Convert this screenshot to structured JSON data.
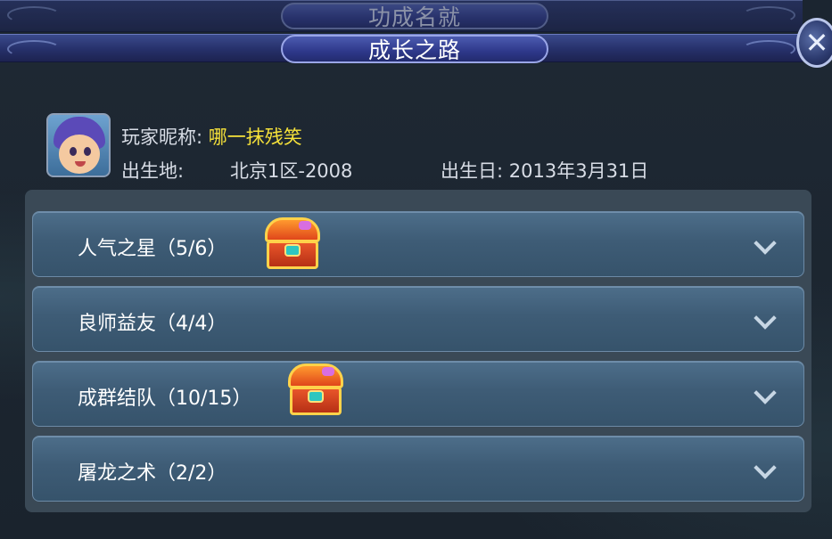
{
  "header": {
    "back_tab_title": "功成名就",
    "front_tab_title": "成长之路",
    "close_symbol": "✕"
  },
  "player": {
    "nickname_label": "玩家昵称:",
    "nickname": "哪一抹残笑",
    "birthplace_label": "出生地:",
    "birthplace": "北京1区-2008",
    "birthday_label": "出生日:",
    "birthday": "2013年3月31日"
  },
  "achievements": [
    {
      "label": "人气之星（5/6）",
      "has_chest": true
    },
    {
      "label": "良师益友（4/4）",
      "has_chest": false
    },
    {
      "label": "成群结队（10/15）",
      "has_chest": true
    },
    {
      "label": "屠龙之术（2/2）",
      "has_chest": false
    }
  ],
  "colors": {
    "nickname": "#f6e23a",
    "banner": "#2e388a",
    "row": "#3e5c76",
    "panel": "#3a4956"
  }
}
